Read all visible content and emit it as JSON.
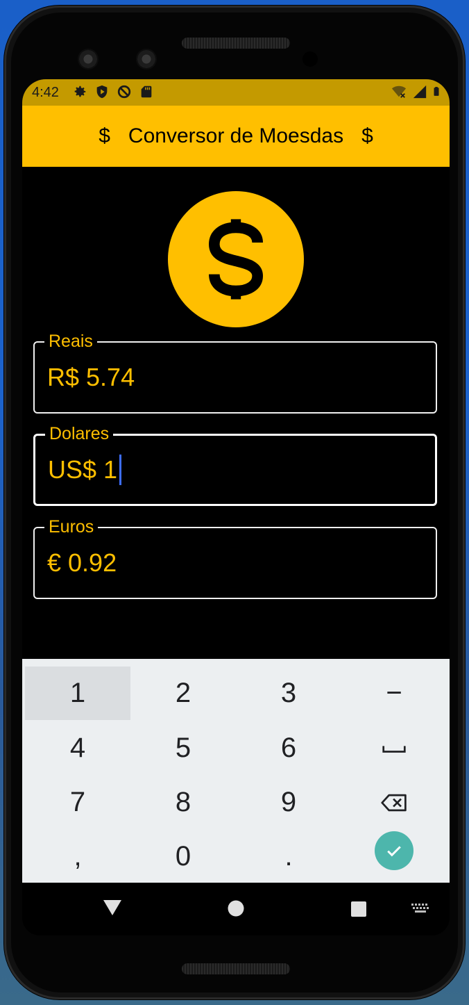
{
  "status_bar": {
    "time": "4:42",
    "left_icons": [
      "gear-icon",
      "shield-play-icon",
      "no-entry-icon",
      "sd-card-icon"
    ],
    "right_icons": [
      "wifi-off-icon",
      "signal-icon",
      "battery-icon"
    ]
  },
  "app_bar": {
    "left_symbol": "$",
    "title": "Conversor de Moesdas",
    "right_symbol": "$"
  },
  "logo": {
    "symbol": "$",
    "color": "#ffbf00"
  },
  "fields": [
    {
      "label": "Reais",
      "value": "R$ 5.74",
      "focused": false
    },
    {
      "label": "Dolares",
      "value": "US$ 1",
      "focused": true
    },
    {
      "label": "Euros",
      "value": "€ 0.92",
      "focused": false
    }
  ],
  "keyboard": {
    "keys": [
      [
        "1",
        "2",
        "3",
        "−"
      ],
      [
        "4",
        "5",
        "6",
        "space-icon"
      ],
      [
        "7",
        "8",
        "9",
        "backspace-icon"
      ],
      [
        ",",
        "0",
        ".",
        "done-icon"
      ]
    ],
    "k1": "1",
    "k2": "2",
    "k3": "3",
    "minus": "−",
    "k4": "4",
    "k5": "5",
    "k6": "6",
    "k7": "7",
    "k8": "8",
    "k9": "9",
    "comma": ",",
    "k0": "0",
    "dot": "."
  },
  "nav_bar": {
    "icons": [
      "back-icon",
      "home-icon",
      "recents-icon",
      "keyboard-switch-icon"
    ]
  },
  "colors": {
    "accent": "#ffbf00",
    "status_bar": "#c49a00",
    "cursor": "#3d6dff",
    "done_key": "#4db6ac"
  }
}
